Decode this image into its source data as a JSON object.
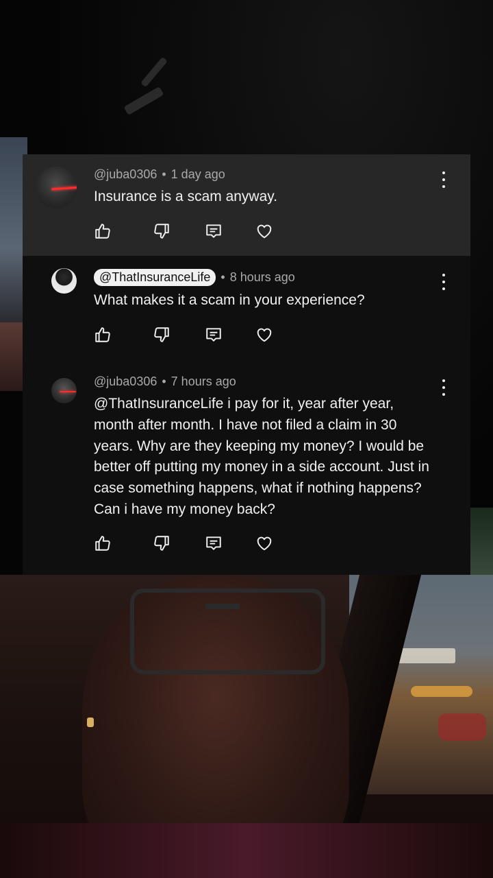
{
  "comments": [
    {
      "author": "@juba0306",
      "time": "1 day ago",
      "text": "Insurance is a scam anyway.",
      "avatar": "vader-avatar"
    },
    {
      "author": "@ThatInsuranceLife",
      "time": "8 hours ago",
      "text": "What makes it a scam in your experience?",
      "avatar": "person-avatar",
      "author_is_creator": true
    },
    {
      "author": "@juba0306",
      "time": "7 hours ago",
      "text": "@ThatInsuranceLife i pay for it, year after year, month after month.  I have not filed a claim in 30 years.  Why are they keeping my money?  I would be better off putting my money in a side account.  Just in case something happens, what if nothing happens? Can i have my money back?",
      "avatar": "vader-avatar"
    }
  ],
  "separator": "•",
  "icons": [
    "thumbs-up-icon",
    "thumbs-down-icon",
    "reply-icon",
    "heart-icon",
    "more-icon"
  ],
  "colors": {
    "panel_bg": "#0f0f0f",
    "highlight_bg": "#272727",
    "text_primary": "#f1f1f1",
    "text_secondary": "#aaaaaa"
  }
}
